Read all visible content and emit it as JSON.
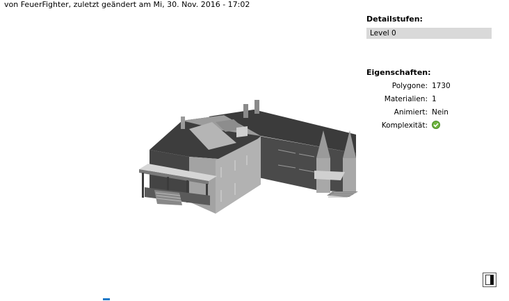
{
  "model": {
    "byline": "von FeuerFighter, zuletzt geändert am Mi, 30. Nov. 2016 - 17:02"
  },
  "detail_levels": {
    "title": "Detailstufen:",
    "selected": "Level 0"
  },
  "properties": {
    "title": "Eigenschaften:",
    "rows": [
      {
        "label": "Polygone:",
        "value": "1730"
      },
      {
        "label": "Materialien:",
        "value": "1"
      },
      {
        "label": "Animiert:",
        "value": "Nein"
      },
      {
        "label": "Komplexität:",
        "value": "",
        "icon": "check-circle-icon"
      }
    ]
  },
  "colors": {
    "select_bg": "#d9d9d9",
    "check_green": "#6fb43f",
    "model_dark": "#3f3f3f",
    "model_light": "#a6a6a6",
    "accent_blue": "#1f78c8"
  },
  "controls": {
    "fullscreen_icon": "fullscreen-toggle-icon"
  }
}
